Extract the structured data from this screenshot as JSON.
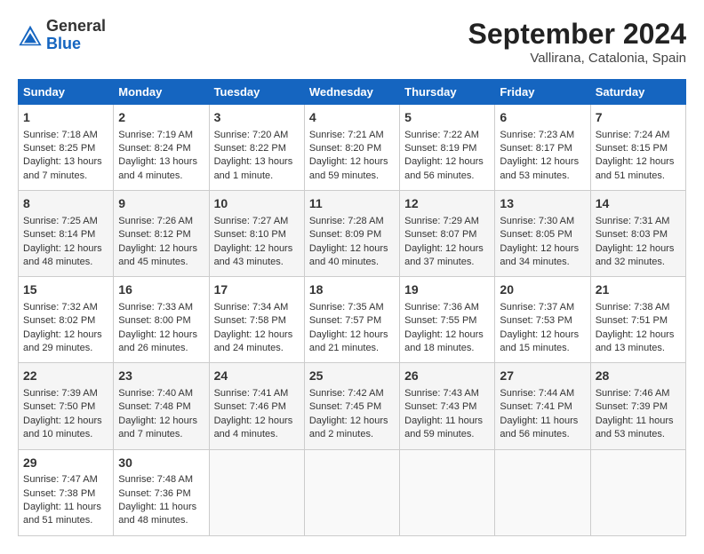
{
  "header": {
    "logo_general": "General",
    "logo_blue": "Blue",
    "month_year": "September 2024",
    "location": "Vallirana, Catalonia, Spain"
  },
  "calendar": {
    "days_of_week": [
      "Sunday",
      "Monday",
      "Tuesday",
      "Wednesday",
      "Thursday",
      "Friday",
      "Saturday"
    ],
    "weeks": [
      [
        {
          "day": "1",
          "sunrise": "Sunrise: 7:18 AM",
          "sunset": "Sunset: 8:25 PM",
          "daylight": "Daylight: 13 hours and 7 minutes."
        },
        {
          "day": "2",
          "sunrise": "Sunrise: 7:19 AM",
          "sunset": "Sunset: 8:24 PM",
          "daylight": "Daylight: 13 hours and 4 minutes."
        },
        {
          "day": "3",
          "sunrise": "Sunrise: 7:20 AM",
          "sunset": "Sunset: 8:22 PM",
          "daylight": "Daylight: 13 hours and 1 minute."
        },
        {
          "day": "4",
          "sunrise": "Sunrise: 7:21 AM",
          "sunset": "Sunset: 8:20 PM",
          "daylight": "Daylight: 12 hours and 59 minutes."
        },
        {
          "day": "5",
          "sunrise": "Sunrise: 7:22 AM",
          "sunset": "Sunset: 8:19 PM",
          "daylight": "Daylight: 12 hours and 56 minutes."
        },
        {
          "day": "6",
          "sunrise": "Sunrise: 7:23 AM",
          "sunset": "Sunset: 8:17 PM",
          "daylight": "Daylight: 12 hours and 53 minutes."
        },
        {
          "day": "7",
          "sunrise": "Sunrise: 7:24 AM",
          "sunset": "Sunset: 8:15 PM",
          "daylight": "Daylight: 12 hours and 51 minutes."
        }
      ],
      [
        {
          "day": "8",
          "sunrise": "Sunrise: 7:25 AM",
          "sunset": "Sunset: 8:14 PM",
          "daylight": "Daylight: 12 hours and 48 minutes."
        },
        {
          "day": "9",
          "sunrise": "Sunrise: 7:26 AM",
          "sunset": "Sunset: 8:12 PM",
          "daylight": "Daylight: 12 hours and 45 minutes."
        },
        {
          "day": "10",
          "sunrise": "Sunrise: 7:27 AM",
          "sunset": "Sunset: 8:10 PM",
          "daylight": "Daylight: 12 hours and 43 minutes."
        },
        {
          "day": "11",
          "sunrise": "Sunrise: 7:28 AM",
          "sunset": "Sunset: 8:09 PM",
          "daylight": "Daylight: 12 hours and 40 minutes."
        },
        {
          "day": "12",
          "sunrise": "Sunrise: 7:29 AM",
          "sunset": "Sunset: 8:07 PM",
          "daylight": "Daylight: 12 hours and 37 minutes."
        },
        {
          "day": "13",
          "sunrise": "Sunrise: 7:30 AM",
          "sunset": "Sunset: 8:05 PM",
          "daylight": "Daylight: 12 hours and 34 minutes."
        },
        {
          "day": "14",
          "sunrise": "Sunrise: 7:31 AM",
          "sunset": "Sunset: 8:03 PM",
          "daylight": "Daylight: 12 hours and 32 minutes."
        }
      ],
      [
        {
          "day": "15",
          "sunrise": "Sunrise: 7:32 AM",
          "sunset": "Sunset: 8:02 PM",
          "daylight": "Daylight: 12 hours and 29 minutes."
        },
        {
          "day": "16",
          "sunrise": "Sunrise: 7:33 AM",
          "sunset": "Sunset: 8:00 PM",
          "daylight": "Daylight: 12 hours and 26 minutes."
        },
        {
          "day": "17",
          "sunrise": "Sunrise: 7:34 AM",
          "sunset": "Sunset: 7:58 PM",
          "daylight": "Daylight: 12 hours and 24 minutes."
        },
        {
          "day": "18",
          "sunrise": "Sunrise: 7:35 AM",
          "sunset": "Sunset: 7:57 PM",
          "daylight": "Daylight: 12 hours and 21 minutes."
        },
        {
          "day": "19",
          "sunrise": "Sunrise: 7:36 AM",
          "sunset": "Sunset: 7:55 PM",
          "daylight": "Daylight: 12 hours and 18 minutes."
        },
        {
          "day": "20",
          "sunrise": "Sunrise: 7:37 AM",
          "sunset": "Sunset: 7:53 PM",
          "daylight": "Daylight: 12 hours and 15 minutes."
        },
        {
          "day": "21",
          "sunrise": "Sunrise: 7:38 AM",
          "sunset": "Sunset: 7:51 PM",
          "daylight": "Daylight: 12 hours and 13 minutes."
        }
      ],
      [
        {
          "day": "22",
          "sunrise": "Sunrise: 7:39 AM",
          "sunset": "Sunset: 7:50 PM",
          "daylight": "Daylight: 12 hours and 10 minutes."
        },
        {
          "day": "23",
          "sunrise": "Sunrise: 7:40 AM",
          "sunset": "Sunset: 7:48 PM",
          "daylight": "Daylight: 12 hours and 7 minutes."
        },
        {
          "day": "24",
          "sunrise": "Sunrise: 7:41 AM",
          "sunset": "Sunset: 7:46 PM",
          "daylight": "Daylight: 12 hours and 4 minutes."
        },
        {
          "day": "25",
          "sunrise": "Sunrise: 7:42 AM",
          "sunset": "Sunset: 7:45 PM",
          "daylight": "Daylight: 12 hours and 2 minutes."
        },
        {
          "day": "26",
          "sunrise": "Sunrise: 7:43 AM",
          "sunset": "Sunset: 7:43 PM",
          "daylight": "Daylight: 11 hours and 59 minutes."
        },
        {
          "day": "27",
          "sunrise": "Sunrise: 7:44 AM",
          "sunset": "Sunset: 7:41 PM",
          "daylight": "Daylight: 11 hours and 56 minutes."
        },
        {
          "day": "28",
          "sunrise": "Sunrise: 7:46 AM",
          "sunset": "Sunset: 7:39 PM",
          "daylight": "Daylight: 11 hours and 53 minutes."
        }
      ],
      [
        {
          "day": "29",
          "sunrise": "Sunrise: 7:47 AM",
          "sunset": "Sunset: 7:38 PM",
          "daylight": "Daylight: 11 hours and 51 minutes."
        },
        {
          "day": "30",
          "sunrise": "Sunrise: 7:48 AM",
          "sunset": "Sunset: 7:36 PM",
          "daylight": "Daylight: 11 hours and 48 minutes."
        },
        {
          "day": "",
          "sunrise": "",
          "sunset": "",
          "daylight": ""
        },
        {
          "day": "",
          "sunrise": "",
          "sunset": "",
          "daylight": ""
        },
        {
          "day": "",
          "sunrise": "",
          "sunset": "",
          "daylight": ""
        },
        {
          "day": "",
          "sunrise": "",
          "sunset": "",
          "daylight": ""
        },
        {
          "day": "",
          "sunrise": "",
          "sunset": "",
          "daylight": ""
        }
      ]
    ]
  }
}
